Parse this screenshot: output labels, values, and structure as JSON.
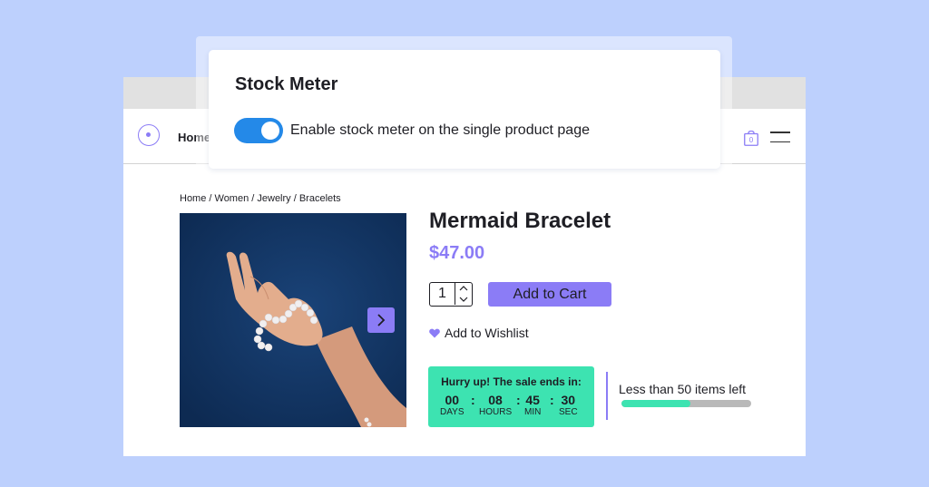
{
  "colors": {
    "background": "#bdd0fd",
    "accent": "#8b7cf6",
    "toggle_on": "#2489e8",
    "sale_green": "#3de3b1",
    "stock_bar_track": "#b9b9b9"
  },
  "settings_popup": {
    "title": "Stock Meter",
    "toggle": {
      "label": "Enable stock meter on the single product page",
      "enabled": true
    }
  },
  "header": {
    "logo_icon": "circle-dot-logo-icon",
    "nav_home": "Home",
    "cart_count": "0",
    "cart_icon": "shopping-bag-icon",
    "menu_icon": "hamburger-menu-icon"
  },
  "breadcrumb": "Home / Women / Jewelry / Bracelets",
  "product": {
    "title": "Mermaid Bracelet",
    "price": "$47.00",
    "quantity": "1",
    "add_to_cart_label": "Add to Cart",
    "wishlist_label": "Add to Wishlist",
    "wishlist_icon": "heart-icon",
    "gallery_next_icon": "chevron-right-icon"
  },
  "sale_timer": {
    "title": "Hurry up! The sale ends in:",
    "units": [
      {
        "value": "00",
        "label": "DAYS"
      },
      {
        "value": "08",
        "label": "HOURS"
      },
      {
        "value": "45",
        "label": "MIN"
      },
      {
        "value": "30",
        "label": "SEC"
      }
    ],
    "separator": ":"
  },
  "stock": {
    "text": "Less than 50 items left",
    "fill_fraction": 0.53
  }
}
